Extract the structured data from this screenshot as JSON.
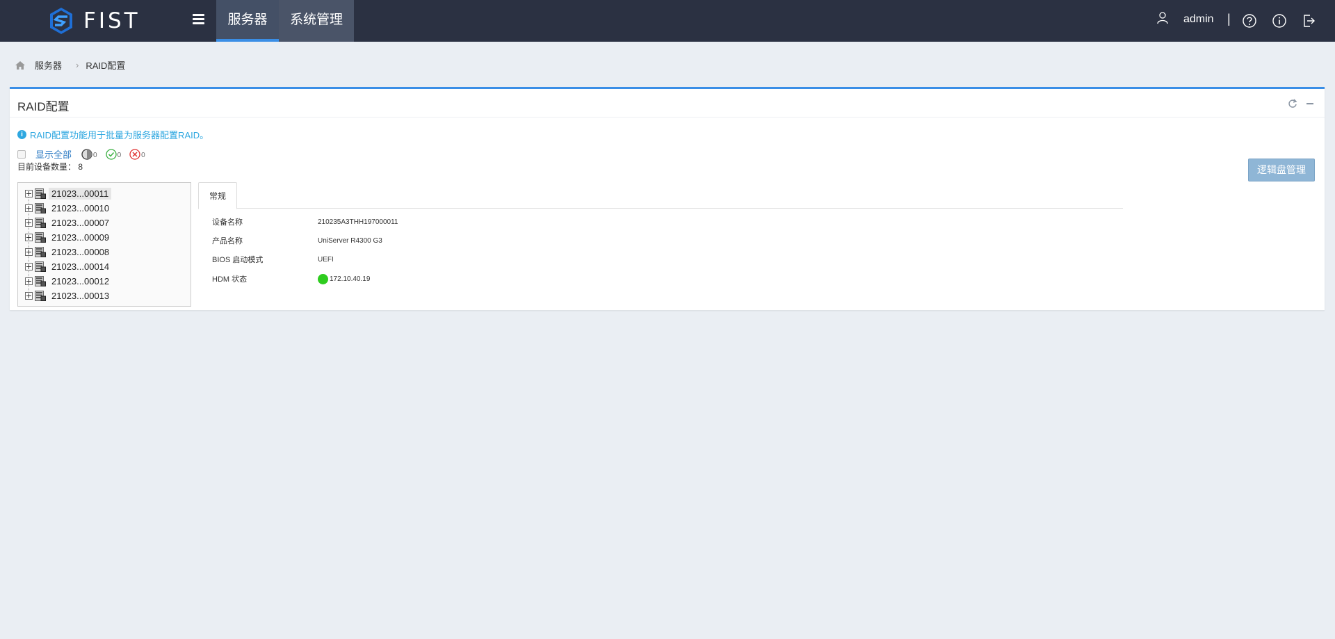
{
  "app": {
    "name": "FIST"
  },
  "nav": {
    "items": [
      {
        "label": "服务器",
        "active": true
      },
      {
        "label": "系统管理",
        "active": false
      }
    ]
  },
  "user": {
    "name": "admin",
    "separator": "|"
  },
  "icons": {
    "help": "help-circle-icon",
    "info": "info-circle-icon",
    "logout": "logout-icon",
    "user": "user-icon"
  },
  "breadcrumb": {
    "items": [
      "服务器",
      "RAID配置"
    ],
    "separator": "›"
  },
  "panel": {
    "title": "RAID配置",
    "info_text": "RAID配置功能用于批量为服务器配置RAID。",
    "filter": {
      "show_all": "显示全部",
      "stat_pending": "0",
      "stat_ok": "0",
      "stat_error": "0"
    },
    "device_count": "目前设备数量： 8",
    "logic_button": "逻辑盘管理"
  },
  "tree": {
    "items": [
      {
        "label": "21023...00011",
        "selected": true
      },
      {
        "label": "21023...00010"
      },
      {
        "label": "21023...00007"
      },
      {
        "label": "21023...00009"
      },
      {
        "label": "21023...00008"
      },
      {
        "label": "21023...00014"
      },
      {
        "label": "21023...00012"
      },
      {
        "label": "21023...00013"
      }
    ]
  },
  "detail": {
    "tab": "常规",
    "rows": [
      {
        "key": "设备名称",
        "value": "210235A3THH197000011"
      },
      {
        "key": "产品名称",
        "value": "UniServer R4300 G3"
      },
      {
        "key": "BIOS 启动模式",
        "value": "UEFI"
      },
      {
        "key": "HDM 状态",
        "value": "172.10.40.19"
      }
    ]
  },
  "colors": {
    "topbar": "#2b3142",
    "accent": "#3a8ee6",
    "status_ok": "#2ecc1f",
    "info": "#2ea7e0"
  }
}
